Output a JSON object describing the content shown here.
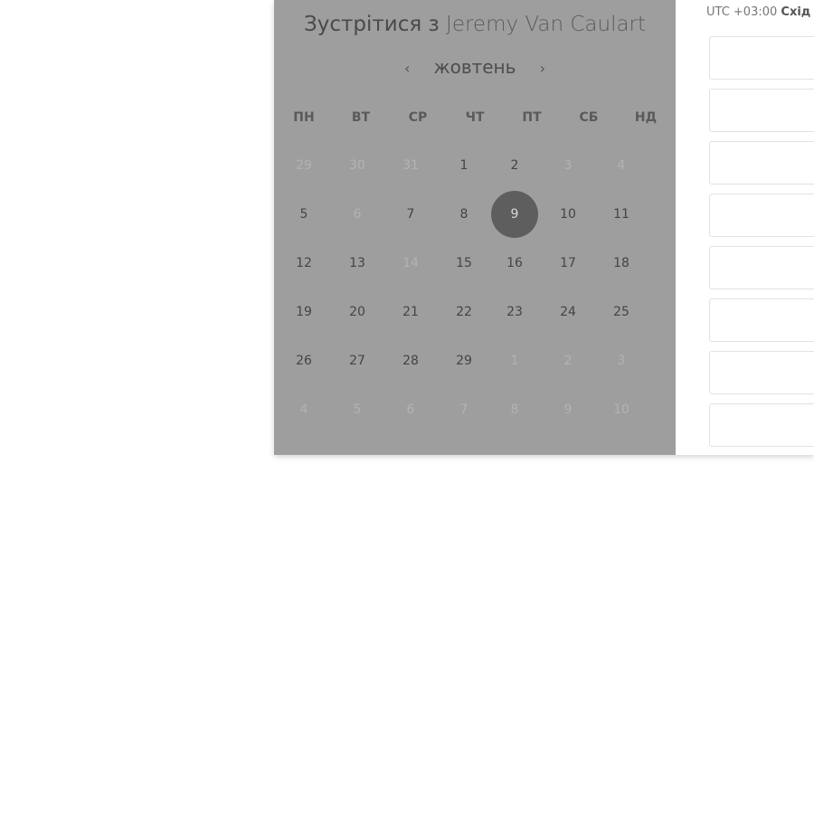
{
  "meeting": {
    "prefix": "Зустрітися з",
    "host_name": "Jeremy Van Caulart"
  },
  "calendar": {
    "month_label": "жовтень",
    "prev_arrow": "‹",
    "next_arrow": "›",
    "weekdays": [
      "ПН",
      "ВТ",
      "СР",
      "ЧТ",
      "ПТ",
      "СБ",
      "НД"
    ],
    "weeks": [
      [
        {
          "d": "29",
          "dim": true
        },
        {
          "d": "30",
          "dim": true
        },
        {
          "d": "31",
          "dim": true
        },
        {
          "d": "1"
        },
        {
          "d": "2"
        },
        {
          "d": "3",
          "dim": true
        },
        {
          "d": "4",
          "dim": true
        }
      ],
      [
        {
          "d": "5"
        },
        {
          "d": "6",
          "dim": true
        },
        {
          "d": "7"
        },
        {
          "d": "8"
        },
        {
          "d": "9",
          "selected": true
        },
        {
          "d": "10"
        },
        {
          "d": "11"
        }
      ],
      [
        {
          "d": "12"
        },
        {
          "d": "13"
        },
        {
          "d": "14",
          "dim": true
        },
        {
          "d": "15"
        },
        {
          "d": "16"
        },
        {
          "d": "17"
        },
        {
          "d": "18"
        }
      ],
      [
        {
          "d": "19"
        },
        {
          "d": "20"
        },
        {
          "d": "21"
        },
        {
          "d": "22"
        },
        {
          "d": "23"
        },
        {
          "d": "24"
        },
        {
          "d": "25"
        }
      ],
      [
        {
          "d": "26"
        },
        {
          "d": "27"
        },
        {
          "d": "28"
        },
        {
          "d": "29"
        },
        {
          "d": "1",
          "dim": true
        },
        {
          "d": "2",
          "dim": true
        },
        {
          "d": "3",
          "dim": true
        }
      ],
      [
        {
          "d": "4",
          "dim": true
        },
        {
          "d": "5",
          "dim": true
        },
        {
          "d": "6",
          "dim": true
        },
        {
          "d": "7",
          "dim": true
        },
        {
          "d": "8",
          "dim": true
        },
        {
          "d": "9",
          "dim": true
        },
        {
          "d": "10",
          "dim": true
        }
      ]
    ]
  },
  "timezone": {
    "offset": "UTC +03:00",
    "region": "Схід"
  },
  "time_slots": [
    "",
    "",
    "",
    "",
    "",
    "",
    "",
    ""
  ],
  "colors": {
    "overlay": "#9e9e9e",
    "selected_day": "#5e5e5e",
    "slot_border": "#e2e2e2"
  }
}
